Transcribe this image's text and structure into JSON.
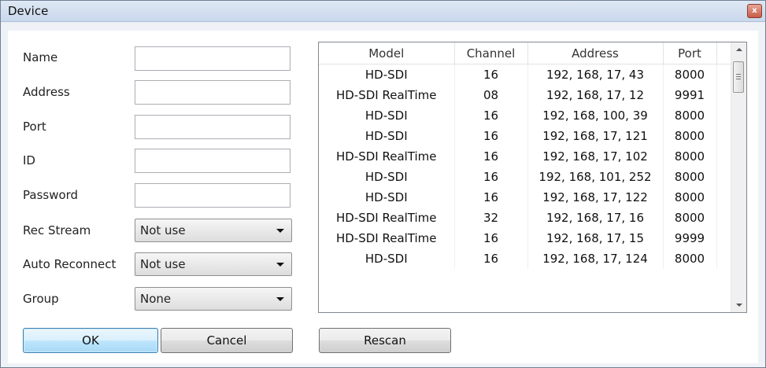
{
  "window": {
    "title": "Device",
    "close_glyph": "x"
  },
  "form": {
    "fields": [
      {
        "label": "Name",
        "value": ""
      },
      {
        "label": "Address",
        "value": ""
      },
      {
        "label": "Port",
        "value": ""
      },
      {
        "label": "ID",
        "value": ""
      },
      {
        "label": "Password",
        "value": ""
      }
    ],
    "selects": [
      {
        "label": "Rec Stream",
        "value": "Not use"
      },
      {
        "label": "Auto Reconnect",
        "value": "Not use"
      },
      {
        "label": "Group",
        "value": "None"
      }
    ]
  },
  "buttons": {
    "ok": "OK",
    "cancel": "Cancel",
    "rescan": "Rescan"
  },
  "device_list": {
    "columns": [
      "Model",
      "Channel",
      "Address",
      "Port"
    ],
    "rows": [
      [
        "HD-SDI",
        "16",
        "192, 168, 17, 43",
        "8000"
      ],
      [
        "HD-SDI RealTime",
        "08",
        "192, 168, 17, 12",
        "9991"
      ],
      [
        "HD-SDI",
        "16",
        "192, 168, 100, 39",
        "8000"
      ],
      [
        "HD-SDI",
        "16",
        "192, 168, 17, 121",
        "8000"
      ],
      [
        "HD-SDI RealTime",
        "16",
        "192, 168, 17, 102",
        "8000"
      ],
      [
        "HD-SDI",
        "16",
        "192, 168, 101, 252",
        "8000"
      ],
      [
        "HD-SDI",
        "16",
        "192, 168, 17, 122",
        "8000"
      ],
      [
        "HD-SDI RealTime",
        "32",
        "192, 168, 17, 16",
        "8000"
      ],
      [
        "HD-SDI RealTime",
        "16",
        "192, 168, 17, 15",
        "9999"
      ],
      [
        "HD-SDI",
        "16",
        "192, 168, 17, 124",
        "8000"
      ]
    ]
  },
  "colors": {
    "window_bg": "#eef2f7",
    "titlebar": "#c9d8ec",
    "close": "#c75d48",
    "ok_button": "#bee6fd"
  }
}
